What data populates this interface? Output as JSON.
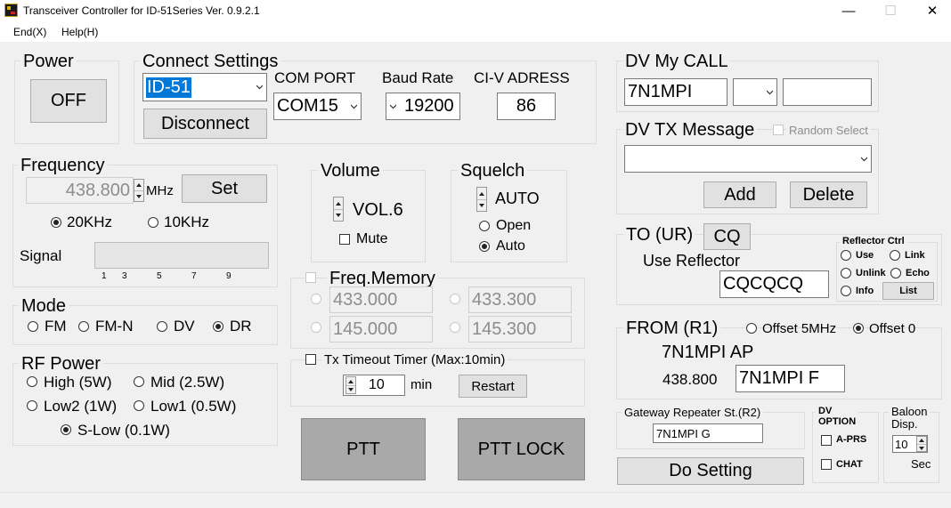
{
  "window": {
    "title": "Transceiver Controller for ID-51Series  Ver. 0.9.2.1",
    "minimize_glyph": "—",
    "maximize_glyph": "☐",
    "close_glyph": "✕"
  },
  "menu": {
    "end": "End(X)",
    "help": "Help(H)"
  },
  "power": {
    "title": "Power",
    "button": "OFF"
  },
  "connect": {
    "title": "Connect Settings",
    "model": "ID-51",
    "disconnect": "Disconnect",
    "com_label": "COM PORT",
    "com_value": "COM15",
    "baud_label": "Baud Rate",
    "baud_value": "19200",
    "civ_label": "CI-V ADRESS",
    "civ_value": "86"
  },
  "frequency": {
    "title": "Frequency",
    "value": "438.800",
    "unit": "MHz",
    "set": "Set",
    "step_20": "20KHz",
    "step_10": "10KHz",
    "signal_label": "Signal",
    "scale": [
      "1",
      "3",
      "5",
      "7",
      "9"
    ]
  },
  "volume": {
    "title": "Volume",
    "value": "VOL.6",
    "mute": "Mute"
  },
  "squelch": {
    "title": "Squelch",
    "value": "AUTO",
    "open": "Open",
    "auto": "Auto"
  },
  "mode": {
    "title": "Mode",
    "options": [
      "FM",
      "FM-N",
      "DV",
      "DR"
    ],
    "selected": "DR"
  },
  "freq_memory": {
    "title": "Freq.Memory",
    "m1": "433.000",
    "m2": "433.300",
    "m3": "145.000",
    "m4": "145.300"
  },
  "rf_power": {
    "title": "RF Power",
    "high": "High (5W)",
    "mid": "Mid (2.5W)",
    "low2": "Low2 (1W)",
    "low1": "Low1 (0.5W)",
    "slow": "S-Low (0.1W)",
    "selected": "S-Low (0.1W)"
  },
  "tx_timer": {
    "label": "Tx Timeout Timer (Max:10min)",
    "value": "10",
    "unit": "min",
    "restart": "Restart"
  },
  "ptt": {
    "ptt": "PTT",
    "lock": "PTT LOCK"
  },
  "dv_mycall": {
    "title": "DV My CALL",
    "call": "7N1MPI",
    "suffix": "",
    "memo": ""
  },
  "dv_tx": {
    "title": "DV TX Message",
    "random": "Random Select",
    "message": "",
    "add": "Add",
    "delete": "Delete"
  },
  "to": {
    "title": "TO (UR)",
    "cq": "CQ",
    "use_reflector": "Use Reflector",
    "value": "CQCQCQ"
  },
  "reflector_ctrl": {
    "title": "Reflector Ctrl",
    "use": "Use",
    "link": "Link",
    "unlink": "Unlink",
    "echo": "Echo",
    "info": "Info",
    "list": "List"
  },
  "from": {
    "title": "FROM (R1)",
    "offset5": "Offset 5MHz",
    "offset0": "Offset 0",
    "repeater": "7N1MPI AP",
    "freq": "438.800",
    "value": "7N1MPI F"
  },
  "gateway": {
    "title": "Gateway Repeater St.(R2)",
    "value": "7N1MPI G"
  },
  "dv_option": {
    "title1": "DV",
    "title2": "OPTION",
    "aprs": "A-PRS",
    "chat": "CHAT"
  },
  "baloon": {
    "title1": "Baloon",
    "title2": "Disp.",
    "value": "10",
    "unit": "Sec"
  },
  "do_setting": "Do Setting"
}
